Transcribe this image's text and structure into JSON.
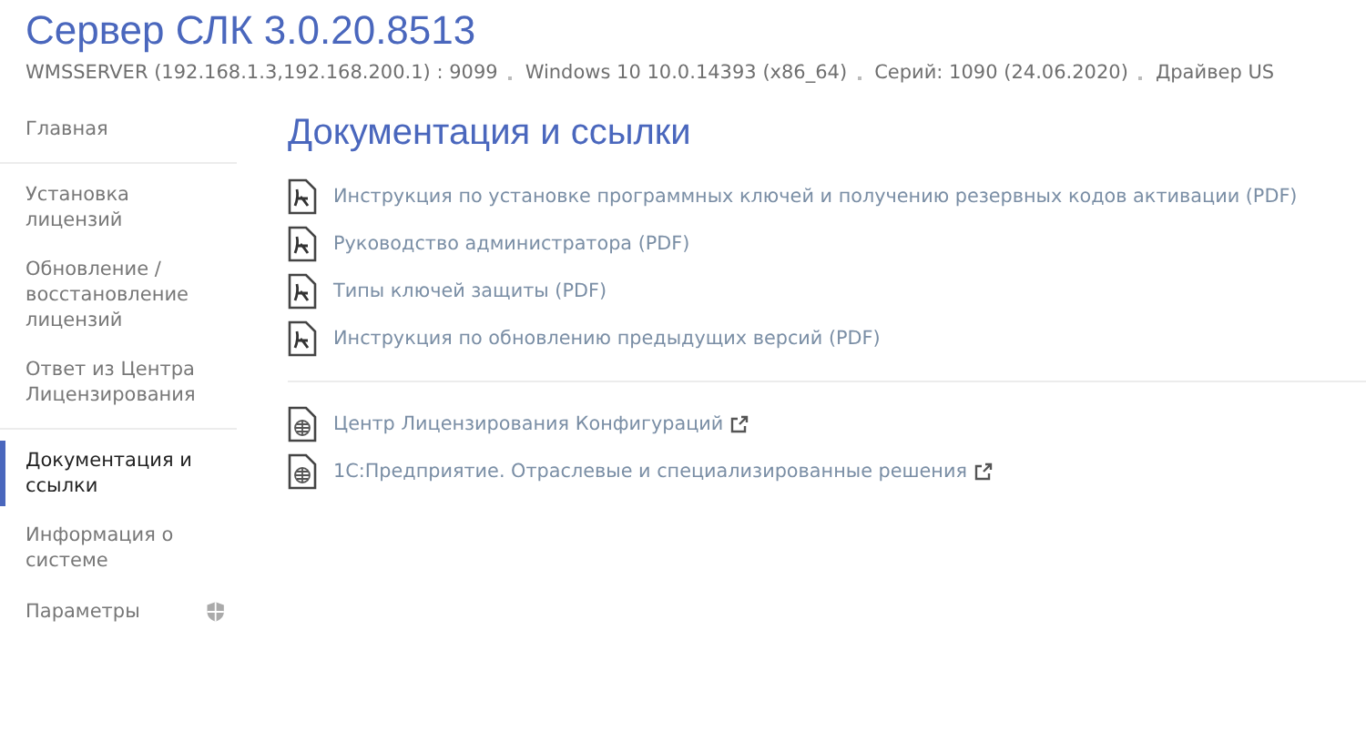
{
  "header": {
    "title": "Сервер СЛК 3.0.20.8513",
    "info": [
      "WMSSERVER (192.168.1.3,192.168.200.1) : 9099",
      "Windows 10 10.0.14393 (x86_64)",
      "Серий: 1090 (24.06.2020)",
      "Драйвер US"
    ]
  },
  "sidebar": {
    "groups": [
      {
        "items": [
          {
            "label": "Главная",
            "selected": false
          }
        ]
      },
      {
        "items": [
          {
            "label": "Установка лицензий",
            "selected": false
          },
          {
            "label": "Обновление / восстановление лицензий",
            "selected": false
          },
          {
            "label": "Ответ из Центра Лицензирования",
            "selected": false
          }
        ]
      },
      {
        "items": [
          {
            "label": "Документация и ссылки",
            "selected": true
          },
          {
            "label": "Информация о системе",
            "selected": false
          },
          {
            "label": "Параметры",
            "selected": false,
            "shield": true
          }
        ]
      }
    ]
  },
  "content": {
    "heading": "Документация и ссылки",
    "sections": [
      {
        "links": [
          {
            "kind": "pdf",
            "label": "Инструкция по установке программных ключей и получению резервных кодов активации (PDF)",
            "external": false
          },
          {
            "kind": "pdf",
            "label": "Руководство администратора (PDF)",
            "external": false
          },
          {
            "kind": "pdf",
            "label": "Типы ключей защиты (PDF)",
            "external": false
          },
          {
            "kind": "pdf",
            "label": "Инструкция по обновлению предыдущих версий (PDF)",
            "external": false
          }
        ]
      },
      {
        "links": [
          {
            "kind": "web",
            "label": "Центр Лицензирования Конфигураций",
            "external": true
          },
          {
            "kind": "web",
            "label": "1С:Предприятие. Отраслевые и специализированные решения",
            "external": true
          }
        ]
      }
    ]
  }
}
